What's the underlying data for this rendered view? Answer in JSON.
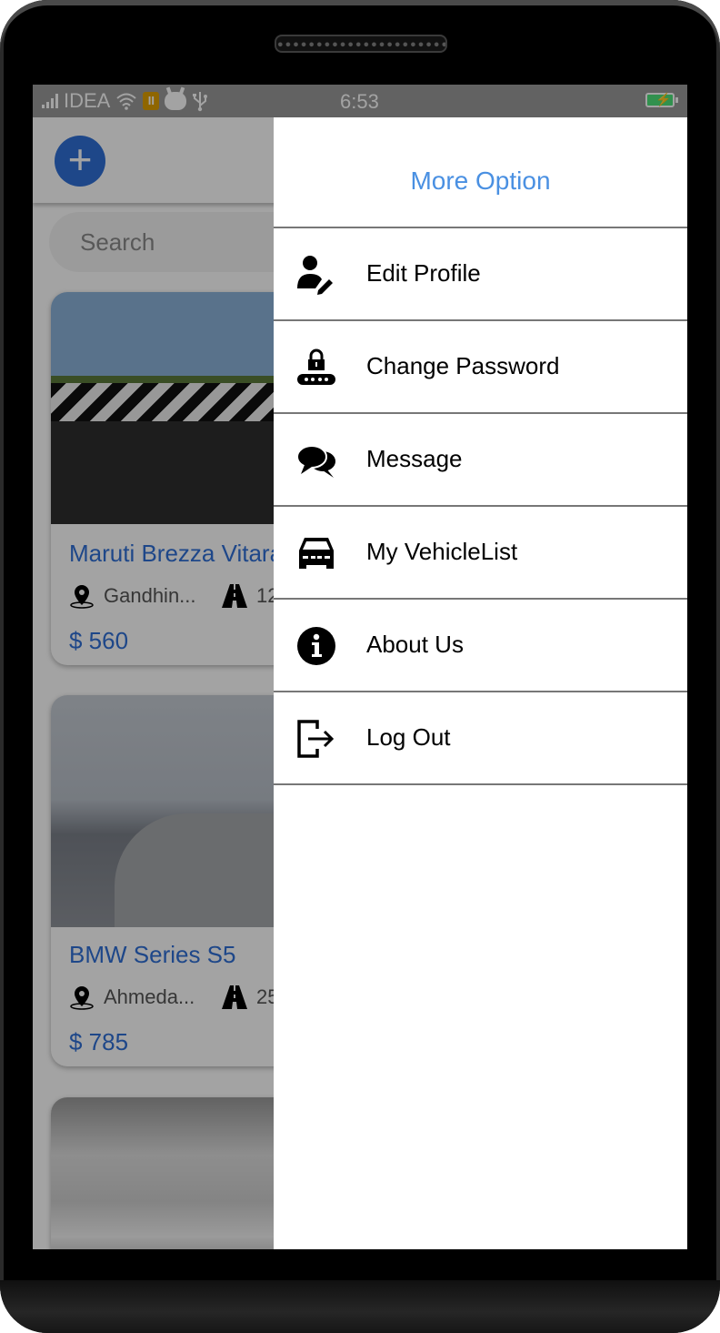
{
  "status_bar": {
    "carrier": "IDEA",
    "time": "6:53",
    "icons": [
      "signal-icon",
      "wifi-icon",
      "app-notification-icon",
      "cat-app-icon",
      "usb-icon",
      "battery-charging-icon"
    ],
    "battery_color": "#4ee37a"
  },
  "app": {
    "add_button_icon": "plus-icon",
    "search": {
      "placeholder": "Search"
    },
    "listings": [
      {
        "title": "Maruti Brezza Vitara",
        "location": "Gandhin...",
        "distance": "12",
        "price": "$ 560",
        "image": "road-chevron-barrier-photo"
      },
      {
        "title": "BMW Series S5",
        "location": "Ahmeda...",
        "distance": "25",
        "price": "$ 785",
        "image": "silver-sedan-mountains-photo"
      },
      {
        "title": "",
        "location": "",
        "distance": "",
        "price": "",
        "image": "white-suv-front-photo"
      }
    ],
    "accent_color": "#2f6fd6"
  },
  "drawer": {
    "title": "More Option",
    "title_color": "#4a90e2",
    "items": [
      {
        "label": "Edit Profile",
        "icon": "user-edit-icon"
      },
      {
        "label": "Change Password",
        "icon": "password-lock-icon"
      },
      {
        "label": "Message",
        "icon": "chat-bubbles-icon"
      },
      {
        "label": "My VehicleList",
        "icon": "car-icon"
      },
      {
        "label": "About Us",
        "icon": "info-icon"
      },
      {
        "label": "Log Out",
        "icon": "logout-icon"
      }
    ]
  }
}
